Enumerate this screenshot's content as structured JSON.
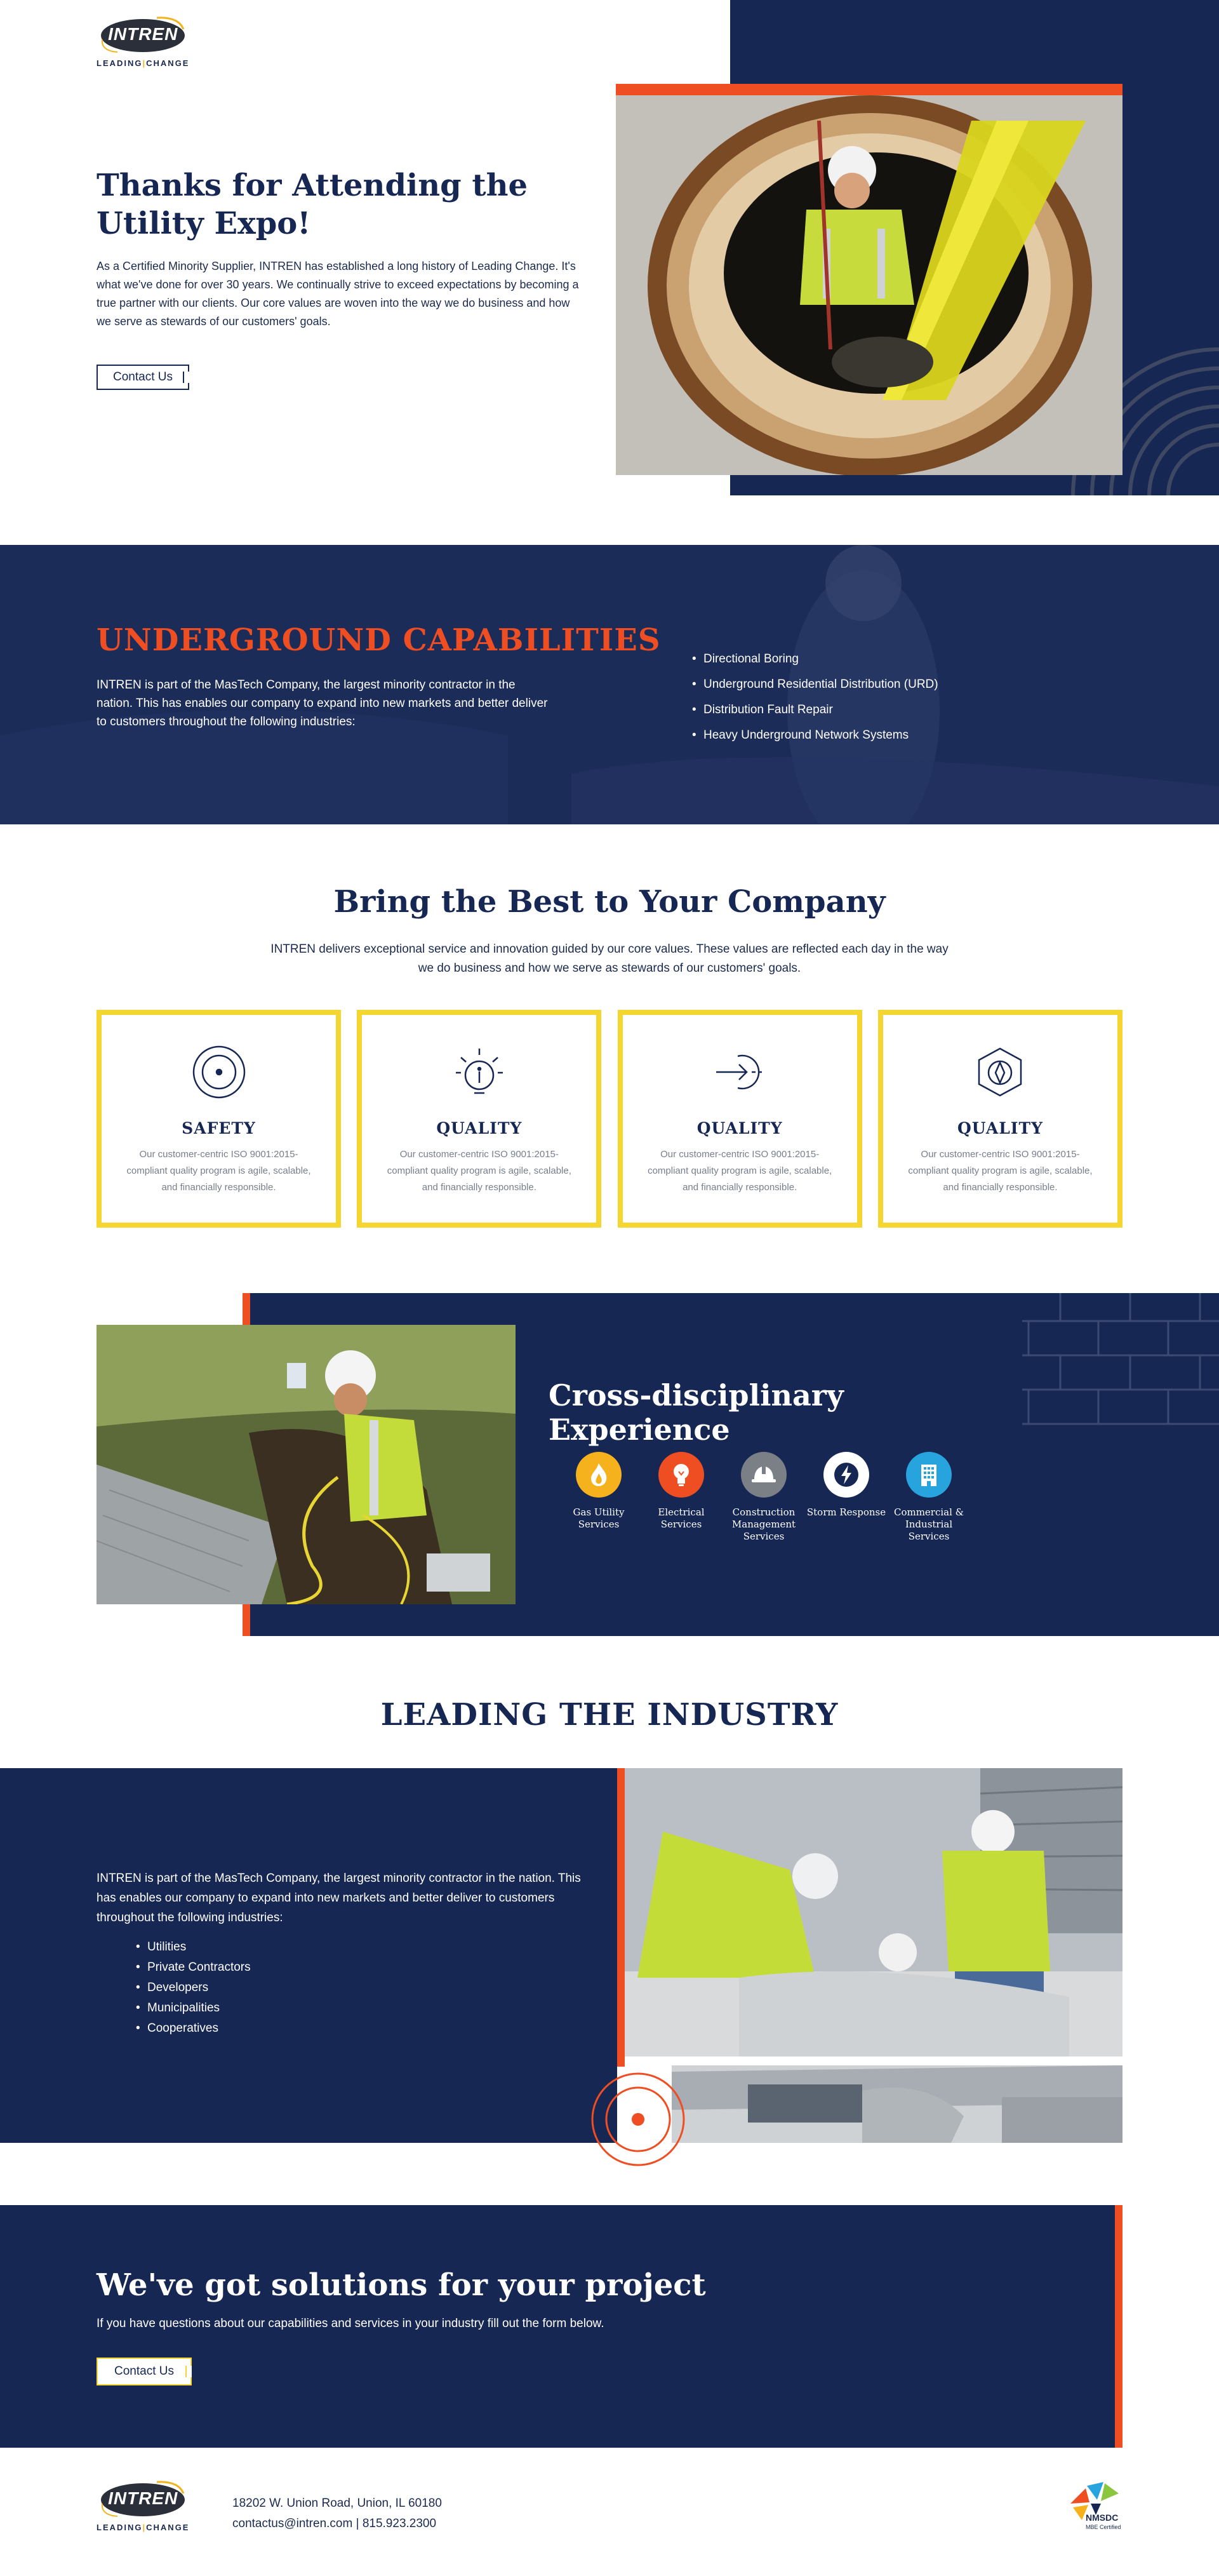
{
  "brand": {
    "logo_word": "INTREN",
    "tagline_left": "LEADING",
    "tagline_mid": "|",
    "tagline_right": "CHANGE",
    "colors": {
      "navy": "#172754",
      "orange": "#ee4e21",
      "yellow": "#f5d630",
      "gold": "#f2b41c"
    }
  },
  "hero": {
    "title": "Thanks for Attending the Utility Expo!",
    "body": "As a Certified Minority Supplier, INTREN has established a long history of Leading Change. It's what we've done for over 30 years. We continually strive to exceed expectations by becoming a true partner with our clients. Our core values are woven into the way we do business and how we serve as stewards of our customers' goals.",
    "cta_label": "Contact Us"
  },
  "underground": {
    "title": "UNDERGROUND CAPABILITIES",
    "body": "INTREN is part of the MasTech Company, the largest minority contractor in the nation. This has enables our company to expand into new markets and better deliver to customers throughout the following industries:",
    "items": [
      "Directional Boring",
      "Underground Residential Distribution (URD)",
      "Distribution Fault Repair",
      "Heavy Underground Network Systems"
    ]
  },
  "best": {
    "title": "Bring the Best to Your Company",
    "subtitle": "INTREN delivers exceptional service and innovation guided by our core values. These values are reflected each day in the way we do business and how we serve as stewards of our customers' goals.",
    "cards": [
      {
        "title": "SAFETY",
        "icon": "target-icon",
        "text": "Our customer-centric ISO 9001:2015-compliant quality program is agile, scalable, and financially responsible."
      },
      {
        "title": "QUALITY",
        "icon": "lightbulb-icon",
        "text": "Our customer-centric ISO 9001:2015-compliant quality program is agile, scalable, and financially responsible."
      },
      {
        "title": "QUALITY",
        "icon": "arrow-in-icon",
        "text": "Our customer-centric ISO 9001:2015-compliant quality program is agile, scalable, and financially responsible."
      },
      {
        "title": "QUALITY",
        "icon": "hexagon-compass-icon",
        "text": "Our customer-centric ISO 9001:2015-compliant quality program is agile, scalable, and financially responsible."
      }
    ]
  },
  "cross": {
    "title": "Cross-disciplinary Experience",
    "services": [
      {
        "label": "Gas Utility Services",
        "icon": "flame-icon",
        "color": "#f5b21c"
      },
      {
        "label": "Electrical Services",
        "icon": "bulb-icon",
        "color": "#ee4e21"
      },
      {
        "label": "Construction Management Services",
        "icon": "hardhat-icon",
        "color": "#7b7f86"
      },
      {
        "label": "Storm Response",
        "icon": "lightning-icon",
        "color": "#ffffff"
      },
      {
        "label": "Commercial & Industrial Services",
        "icon": "building-icon",
        "color": "#27a4de"
      }
    ]
  },
  "leading": {
    "title": "LEADING THE INDUSTRY",
    "body": "INTREN is part of the MasTech Company, the largest minority contractor in the nation. This has enables our company to expand into new markets and better deliver to customers throughout the following industries:",
    "items": [
      "Utilities",
      "Private Contractors",
      "Developers",
      "Municipalities",
      "Cooperatives"
    ]
  },
  "solutions": {
    "title": "We've got solutions for your project",
    "body": "If you have questions about our capabilities and services in your industry fill out the form below.",
    "cta_label": "Contact Us"
  },
  "footer": {
    "address": "18202 W. Union Road, Union, IL 60180",
    "email": "contactus@intren.com",
    "separator": " | ",
    "phone": "815.923.2300",
    "badge_name": "NMSDC",
    "badge_sub": "MBE Certified"
  }
}
